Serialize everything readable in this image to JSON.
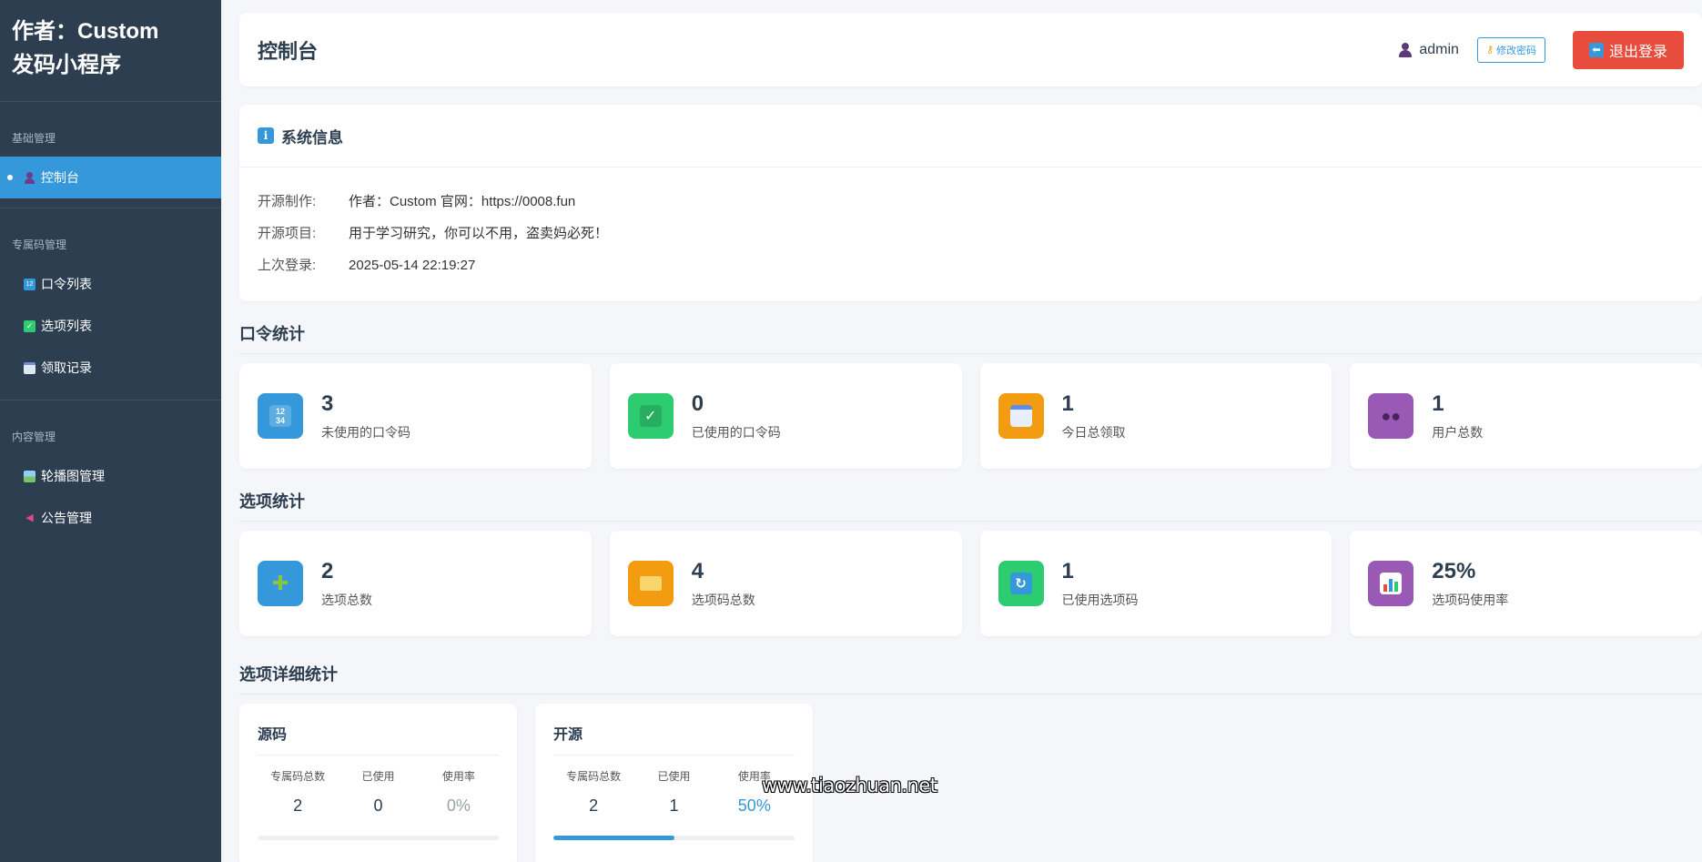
{
  "sidebar": {
    "brand_line1": "作者：Custom",
    "brand_line2": "发码小程序",
    "sections": [
      {
        "title": "基础管理",
        "items": [
          {
            "label": "控制台",
            "icon": "user-icon",
            "active": true
          }
        ]
      },
      {
        "title": "专属码管理",
        "items": [
          {
            "label": "口令列表",
            "icon": "numbers-icon"
          },
          {
            "label": "选项列表",
            "icon": "checkbox-icon"
          },
          {
            "label": "领取记录",
            "icon": "calendar-icon"
          }
        ]
      },
      {
        "title": "内容管理",
        "items": [
          {
            "label": "轮播图管理",
            "icon": "picture-icon"
          },
          {
            "label": "公告管理",
            "icon": "megaphone-icon"
          }
        ]
      }
    ]
  },
  "header": {
    "title": "控制台",
    "username": "admin",
    "change_password": "修改密码",
    "logout": "退出登录"
  },
  "info": {
    "title": "系统信息",
    "rows": [
      {
        "key": "开源制作:",
        "value": "作者：Custom 官网：https://0008.fun"
      },
      {
        "key": "开源项目:",
        "value": "用于学习研究，你可以不用，盗卖妈必死！"
      },
      {
        "key": "上次登录:",
        "value": "2025-05-14 22:19:27"
      }
    ]
  },
  "command_stats": {
    "title": "口令统计",
    "cards": [
      {
        "value": "3",
        "label": "未使用的口令码",
        "icon": "numbers-icon",
        "color": "#3498db"
      },
      {
        "value": "0",
        "label": "已使用的口令码",
        "icon": "checkmark-icon",
        "color": "#2ecc71"
      },
      {
        "value": "1",
        "label": "今日总领取",
        "icon": "calendar-icon",
        "color": "#f39c12"
      },
      {
        "value": "1",
        "label": "用户总数",
        "icon": "users-icon",
        "color": "#9b59b6"
      }
    ]
  },
  "option_stats": {
    "title": "选项统计",
    "cards": [
      {
        "value": "2",
        "label": "选项总数",
        "icon": "puzzle-icon",
        "color": "#3498db"
      },
      {
        "value": "4",
        "label": "选项码总数",
        "icon": "card-icon",
        "color": "#f39c12"
      },
      {
        "value": "1",
        "label": "已使用选项码",
        "icon": "refresh-icon",
        "color": "#2ecc71"
      },
      {
        "value": "25%",
        "label": "选项码使用率",
        "icon": "bar-chart-icon",
        "color": "#9b59b6"
      }
    ]
  },
  "detail_stats": {
    "title": "选项详细统计",
    "headers": [
      "专属码总数",
      "已使用",
      "使用率"
    ],
    "items": [
      {
        "name": "源码",
        "total": "2",
        "used": "0",
        "rate": "0%",
        "fraction": 0
      },
      {
        "name": "开源",
        "total": "2",
        "used": "1",
        "rate": "50%",
        "fraction": 0.5
      }
    ]
  },
  "watermark": "www.tiaozhuan.net"
}
